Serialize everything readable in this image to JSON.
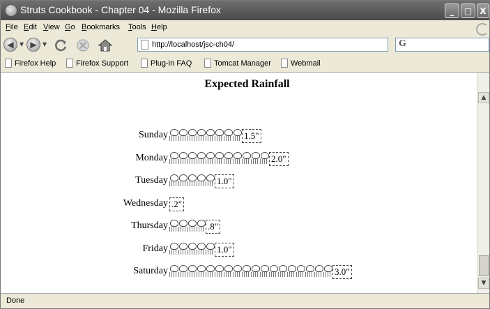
{
  "window": {
    "title": "Struts Cookbook - Chapter 04 - Mozilla Firefox"
  },
  "window_controls": {
    "minimize": "_",
    "maximize": "□",
    "close": "X"
  },
  "menu": [
    "File",
    "Edit",
    "View",
    "Go",
    "Bookmarks",
    "Tools",
    "Help"
  ],
  "navigation": {
    "url": "http://localhost/jsc-ch04/",
    "back_icon": "back-arrow-icon",
    "forward_icon": "forward-arrow-icon",
    "search_engine_glyph": "G"
  },
  "bookmarks": [
    "Firefox Help",
    "Firefox Support",
    "Plug-in FAQ",
    "Tomcat Manager",
    "Webmail"
  ],
  "page": {
    "title": "Expected Rainfall",
    "rows": [
      {
        "day": "Sunday",
        "value": "1.5\"",
        "drops": 8
      },
      {
        "day": "Monday",
        "value": "2.0\"",
        "drops": 11
      },
      {
        "day": "Tuesday",
        "value": "1.0\"",
        "drops": 5
      },
      {
        "day": "Wednesday",
        "value": ".2\"",
        "drops": 0
      },
      {
        "day": "Thursday",
        "value": ".8\"",
        "drops": 4
      },
      {
        "day": "Friday",
        "value": "1.0\"",
        "drops": 5
      },
      {
        "day": "Saturday",
        "value": "3.0\"",
        "drops": 18
      }
    ]
  },
  "status": {
    "text": "Done"
  }
}
